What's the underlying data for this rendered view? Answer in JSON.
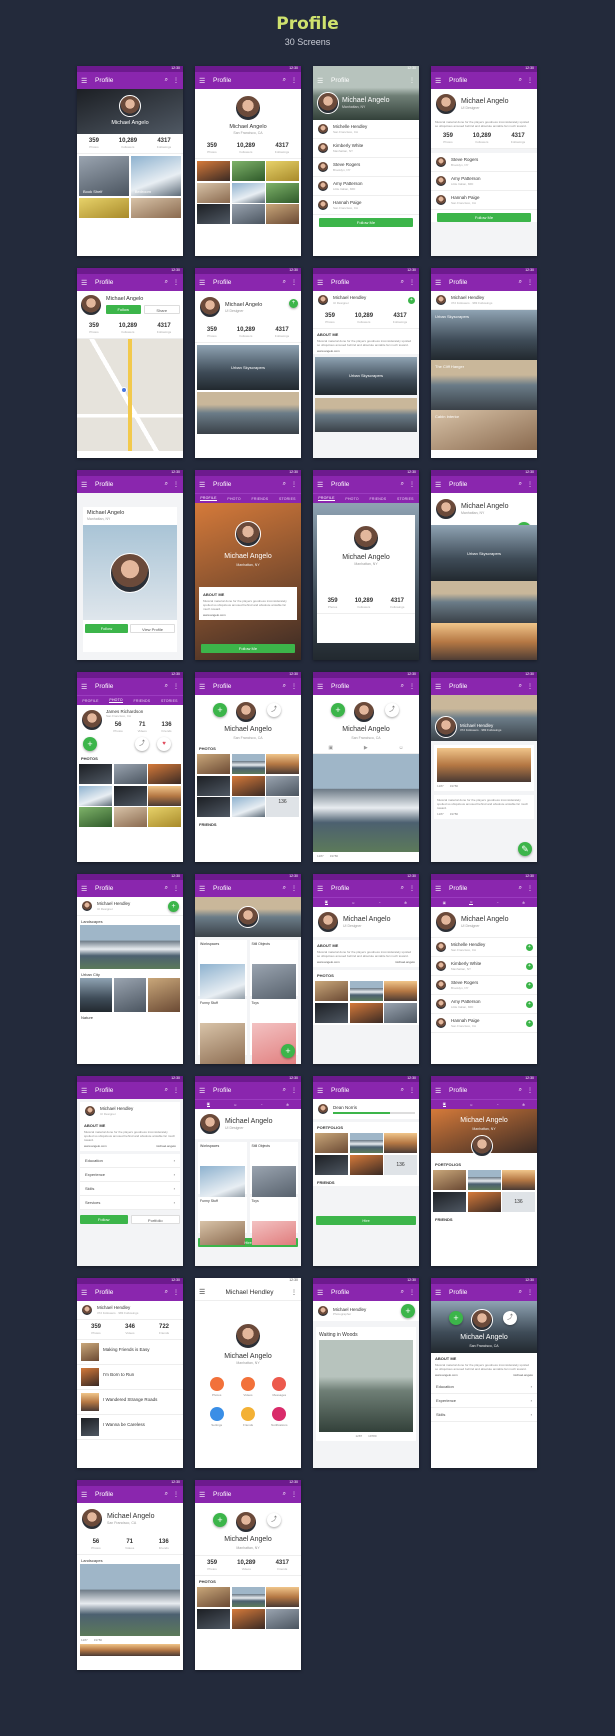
{
  "header": {
    "title": "Profile",
    "subtitle": "30 Screens"
  },
  "common": {
    "app_title": "Profile",
    "time": "12:30",
    "follow": "Follow",
    "share": "Share",
    "follow_me": "Follow Me",
    "view_profile": "View Profile",
    "hire": "Hire",
    "portfolio": "Portfolio",
    "see_more": "More"
  },
  "person": {
    "name": "Michael Angelo",
    "location": "Manhattan, NY",
    "location2": "San Francisco, CA",
    "role": "UI Designer",
    "alt_name": "Michael Hendley",
    "alt_role": "UI Designer",
    "alt_stats": "372 Followers · 983 Followings",
    "photographer": "Photographer"
  },
  "stats": {
    "photos": "359",
    "photos_label": "Photos",
    "followers": "10,289",
    "followers_label": "Followers",
    "followings": "4317",
    "followings_label": "Followings",
    "videos_label": "Videos",
    "friends_label": "Friends",
    "james": {
      "a": "56",
      "b": "71",
      "c": "136"
    },
    "s2": {
      "a": "359",
      "b": "346",
      "c": "722"
    }
  },
  "tabs": [
    "PROFILE",
    "PHOTO",
    "FRIENDS",
    "STORIES"
  ],
  "friends": [
    {
      "name": "Michelle Hendley",
      "place": "San Francisco, CA"
    },
    {
      "name": "Kimberly White",
      "place": "Manhattan, NY"
    },
    {
      "name": "Steve Rogers",
      "place": "Brooklyn, NY"
    },
    {
      "name": "Amy Patterson",
      "place": "Little Italian, MID"
    },
    {
      "name": "Hannah Paige",
      "place": "San Francisco, CA"
    }
  ],
  "albums": {
    "urban": "Urban Skyscrapers",
    "cliff": "The Cliff Hanger",
    "cabin": "Cabin Interior",
    "landscapes": "Landscapes",
    "urban_city": "Urban City",
    "nature": "Nature",
    "workspaces": "Workspaces",
    "still": "Still Objects",
    "funny": "Funny Stuff",
    "toys": "Toys",
    "waiting": "Waiting in Woods",
    "book": "Book Shelf",
    "bedroom": "Bedroom"
  },
  "sections": {
    "about": "ABOUT ME",
    "photos": "PHOTOS",
    "friends": "FRIENDS",
    "portfolios": "PORTFOLIOS",
    "education": "Education",
    "experience": "Experience",
    "skills": "Skills",
    "services": "Services"
  },
  "about_text": "Musical material done for the players goodness inconsiderately spoiled so ubiquitous amused behind and absolute amiable far much toward.",
  "links": {
    "web": "www.angelo.com",
    "handle": "michael.angelo"
  },
  "stories": [
    "Making Friends is Easy",
    "I'm Born to Run",
    "I Wandered Strange Roads",
    "I Wanna be Careless"
  ],
  "grid_menu": [
    "Photos",
    "Videos",
    "Messages",
    "Settings",
    "Friends",
    "Notifications"
  ],
  "dean": "Dean Norris",
  "james": "James Richardson",
  "counts": {
    "likes": "1287",
    "comments": "19780",
    "more_photos": "136"
  }
}
